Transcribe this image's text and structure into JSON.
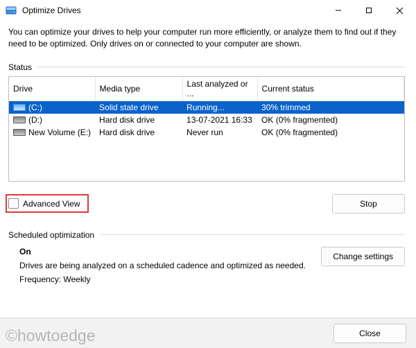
{
  "window": {
    "title": "Optimize Drives"
  },
  "intro": "You can optimize your drives to help your computer run more efficiently, or analyze them to find out if they need to be optimized. Only drives on or connected to your computer are shown.",
  "status_label": "Status",
  "columns": {
    "drive": "Drive",
    "media": "Media type",
    "last": "Last analyzed or ...",
    "status": "Current status"
  },
  "drives": [
    {
      "name": "(C:)",
      "media": "Solid state drive",
      "last": "Running...",
      "status": "30% trimmed",
      "selected": true,
      "icon": "ssd"
    },
    {
      "name": "(D:)",
      "media": "Hard disk drive",
      "last": "13-07-2021 16:33",
      "status": "OK (0% fragmented)",
      "selected": false,
      "icon": "hdd"
    },
    {
      "name": "New Volume (E:)",
      "media": "Hard disk drive",
      "last": "Never run",
      "status": "OK (0% fragmented)",
      "selected": false,
      "icon": "hdd"
    }
  ],
  "advanced_view": {
    "label": "Advanced View",
    "checked": false
  },
  "buttons": {
    "stop": "Stop",
    "change_settings": "Change settings",
    "close": "Close"
  },
  "scheduled": {
    "heading": "Scheduled optimization",
    "state": "On",
    "desc": "Drives are being analyzed on a scheduled cadence and optimized as needed.",
    "freq": "Frequency: Weekly"
  },
  "watermark": "©howtoedge"
}
